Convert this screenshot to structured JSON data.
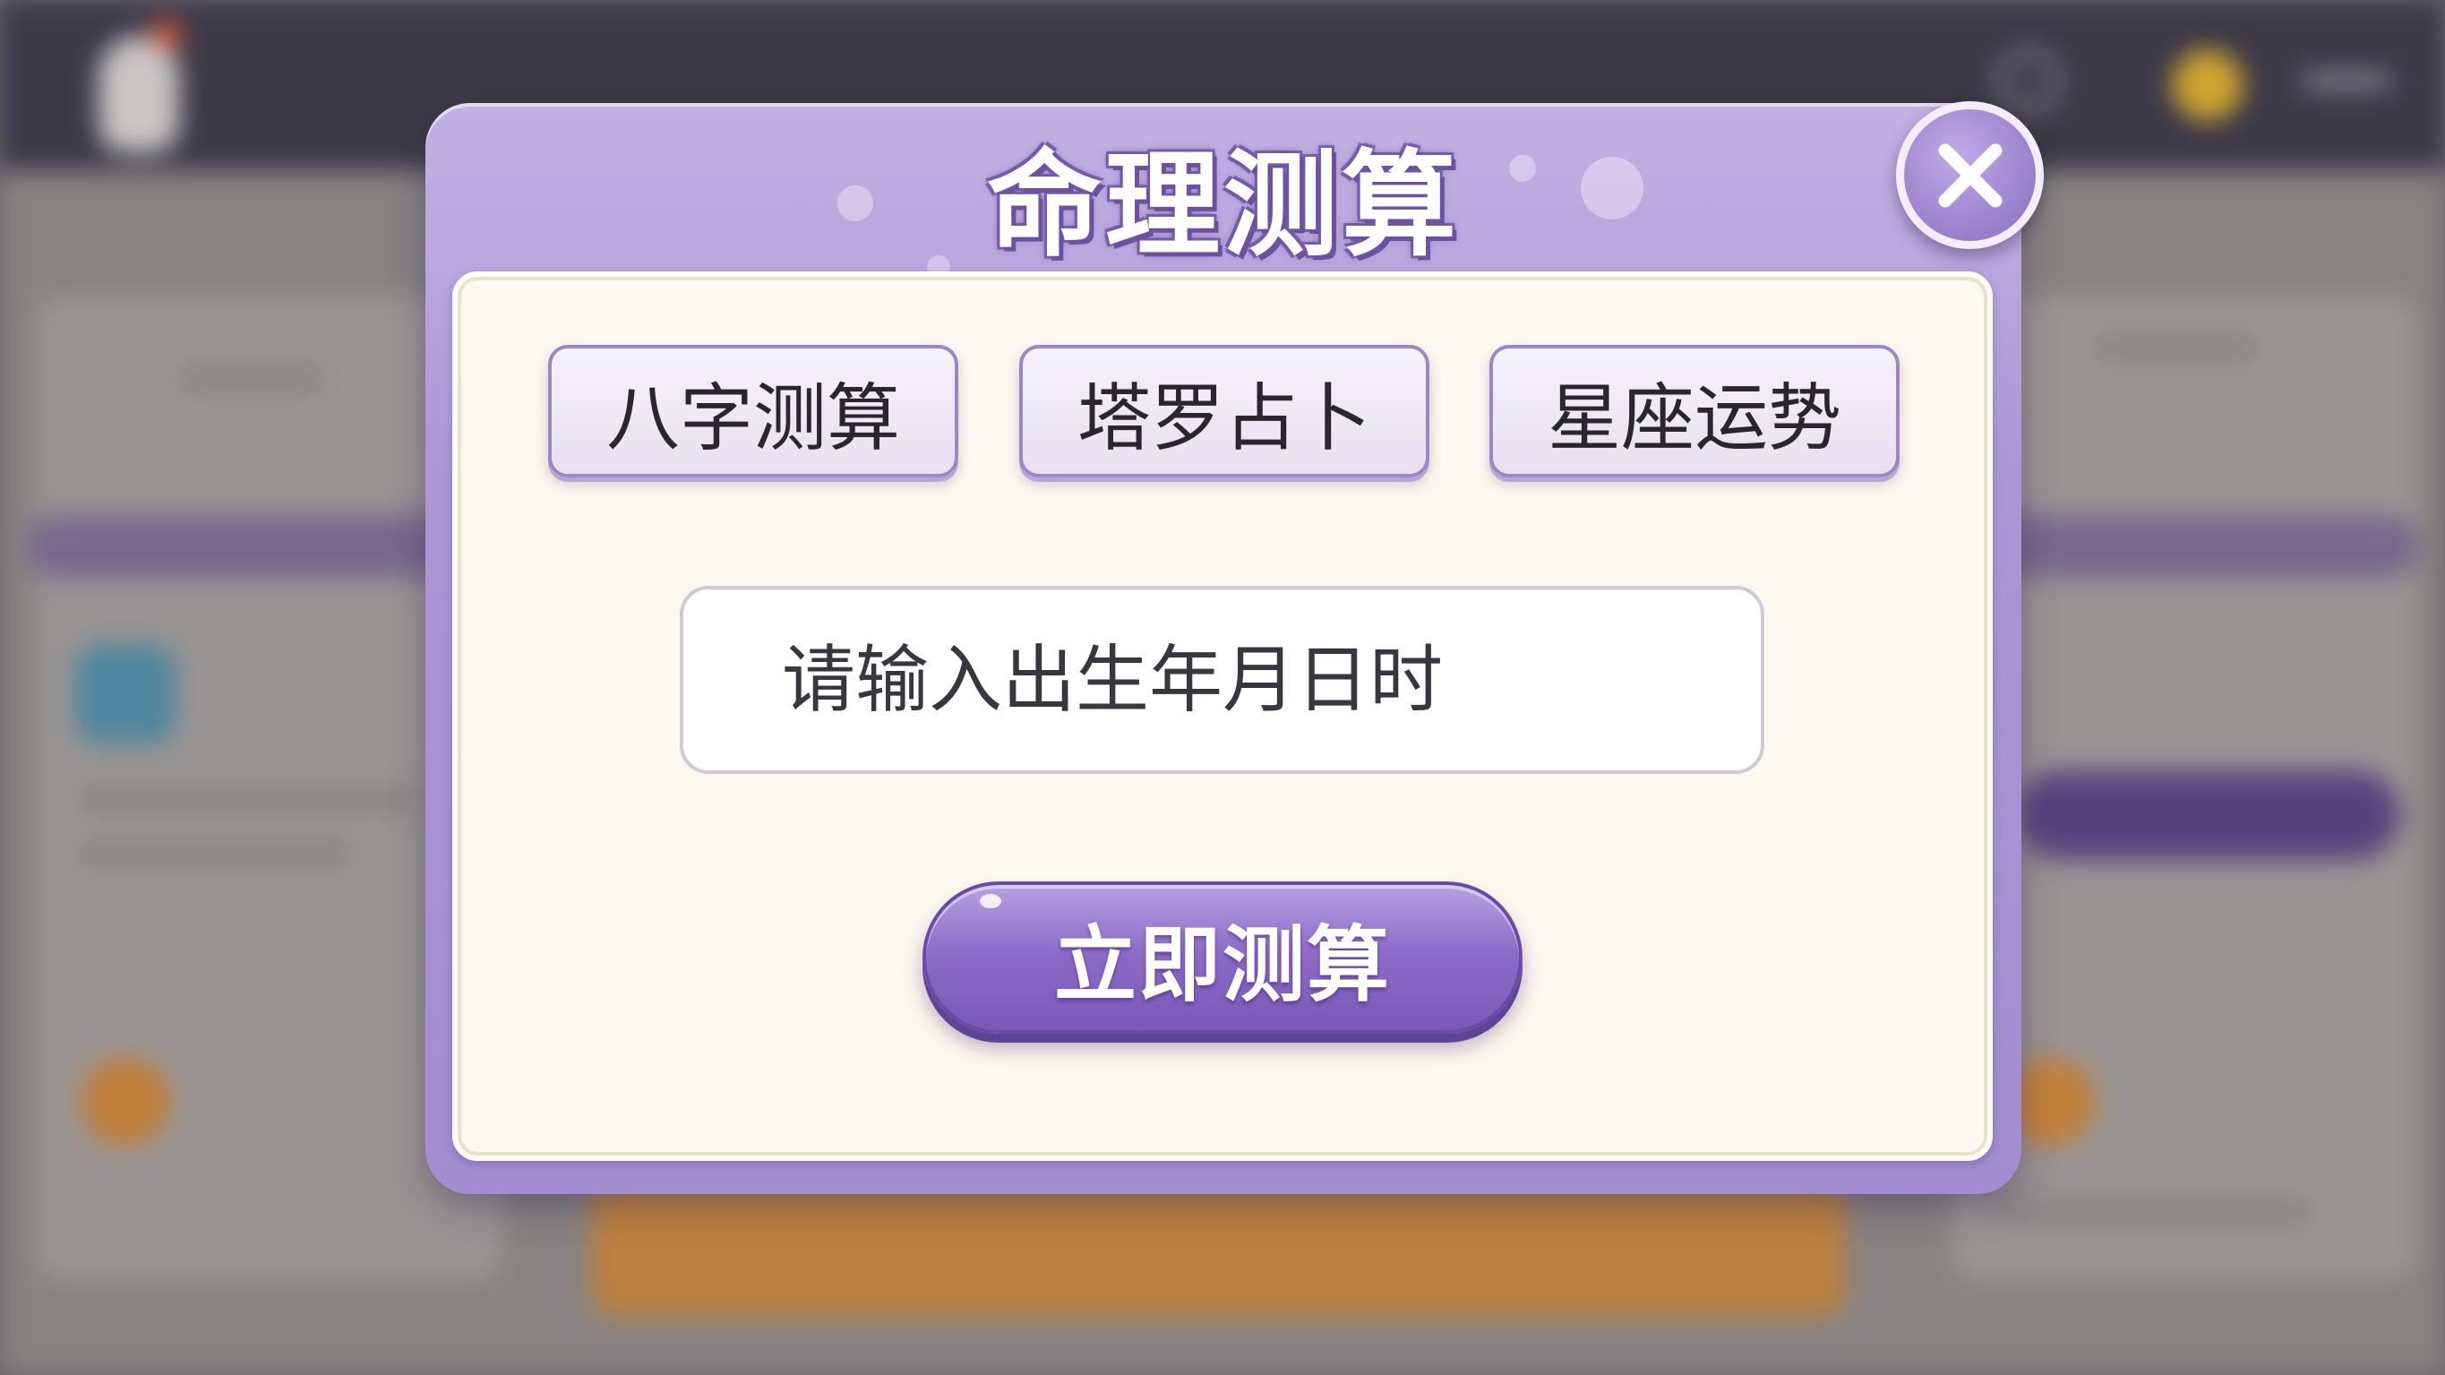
{
  "modal": {
    "title": "命理测算",
    "close_icon": "close-icon",
    "tabs": [
      {
        "label": "八字测算"
      },
      {
        "label": "塔罗占卜"
      },
      {
        "label": "星座运势"
      }
    ],
    "birth_input": {
      "placeholder": "请输入出生年月日时",
      "value": ""
    },
    "submit_label": "立即测算"
  },
  "colors": {
    "modal_purple": "#ab96d6",
    "panel_cream": "#fbf8ef",
    "button_purple": "#8d6dc9"
  }
}
